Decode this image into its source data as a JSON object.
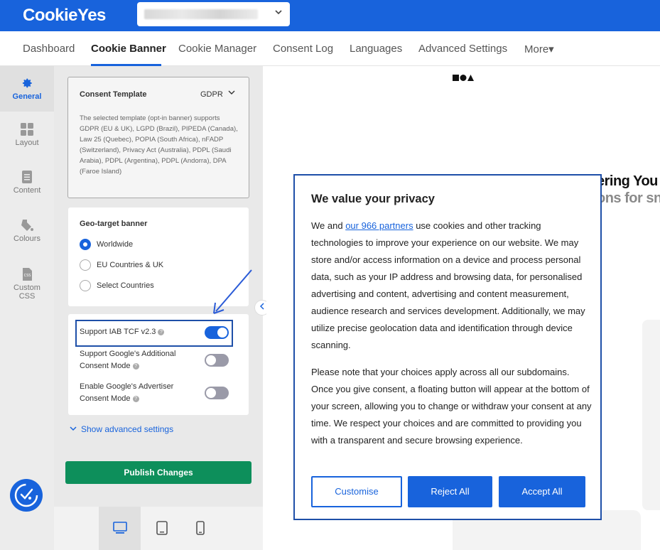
{
  "header": {
    "logo": "CookieYes"
  },
  "nav": {
    "items": [
      "Dashboard",
      "Cookie Banner",
      "Cookie Manager",
      "Consent Log",
      "Languages",
      "Advanced Settings",
      "More▾"
    ]
  },
  "sidebar": {
    "items": [
      {
        "label": "General",
        "icon": "gear-icon"
      },
      {
        "label": "Layout",
        "icon": "layout-icon"
      },
      {
        "label": "Content",
        "icon": "document-icon"
      },
      {
        "label": "Colours",
        "icon": "paint-bucket-icon"
      },
      {
        "label": "Custom",
        "label2": "CSS",
        "icon": "css-file-icon"
      }
    ]
  },
  "consent_template": {
    "title": "Consent Template",
    "value": "GDPR",
    "description": "The selected template (opt-in banner) supports GDPR (EU & UK), LGPD (Brazil), PIPEDA (Canada), Law 25 (Quebec), POPIA (South Africa), nFADP (Switzerland), Privacy Act (Australia), PDPL (Saudi Arabia), PDPL (Argentina), PDPL (Andorra), DPA (Faroe Island)"
  },
  "geo_target": {
    "title": "Geo-target banner",
    "options": [
      "Worldwide",
      "EU Countries & UK",
      "Select Countries"
    ],
    "selected": "Worldwide"
  },
  "options": [
    {
      "label": "Support IAB TCF v2.3",
      "enabled": true
    },
    {
      "label": "Support Google's Additional Consent Mode",
      "enabled": false
    },
    {
      "label": "Enable Google's Advertiser Consent Mode",
      "enabled": false
    }
  ],
  "advanced_link": "Show advanced settings",
  "publish_label": "Publish Changes",
  "preview": {
    "bg_text_line1": "ering You",
    "bg_text_line2": "ons for sn"
  },
  "modal": {
    "title": "We value your privacy",
    "p1_before": "We and ",
    "p1_link": "our 966 partners",
    "p1_after": " use cookies and other tracking technologies to improve your experience on our website. We may store and/or access information on a device and process personal data, such as your IP address and browsing data, for personalised advertising and content, advertising and content measurement, audience research and services development. Additionally, we may utilize precise geolocation data and identification through device scanning.",
    "p2": "Please note that your choices apply across all our subdomains. Once you give consent, a floating button will appear at the bottom of your screen, allowing you to change or withdraw your consent at any time. We respect your choices and are committed to providing you with a transparent and secure browsing experience.",
    "btn_customise": "Customise",
    "btn_reject": "Reject All",
    "btn_accept": "Accept All"
  },
  "colors": {
    "brand": "#1863dc",
    "publish": "#0d8f5b",
    "highlight": "#1e4fa8"
  }
}
